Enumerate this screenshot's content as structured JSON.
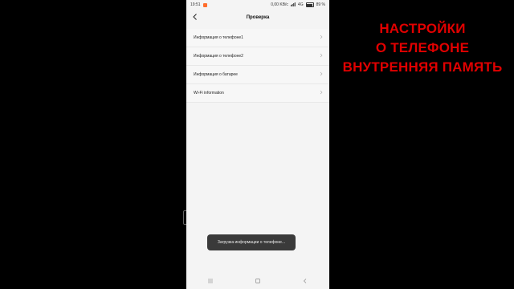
{
  "status_bar": {
    "time": "19:51",
    "network_speed": "0,00 KB/c",
    "network_type": "4G",
    "battery": "89 %"
  },
  "header": {
    "title": "Проверка"
  },
  "menu": {
    "items": [
      {
        "label": "Информация о телефоне1"
      },
      {
        "label": "Информация о телефоне2"
      },
      {
        "label": "Информация о батарее"
      },
      {
        "label": "Wi-Fi information"
      }
    ]
  },
  "toast": {
    "text": "Загрузка информации о телефоне..."
  },
  "overlay_text": {
    "line1": "НАСТРОЙКИ",
    "line2": "О ТЕЛЕФОНЕ",
    "line3": "ВНУТРЕННЯЯ ПАМЯТЬ"
  },
  "colors": {
    "overlay_text": "#e10000",
    "background": "#000000",
    "phone_bg": "#f4f4f4",
    "toast_bg": "#3a3a3a"
  },
  "icons": {
    "back": "back-icon",
    "chevron": "chevron-right-icon",
    "menu": "menu-icon",
    "home": "home-icon",
    "back_nav": "back-nav-icon"
  }
}
